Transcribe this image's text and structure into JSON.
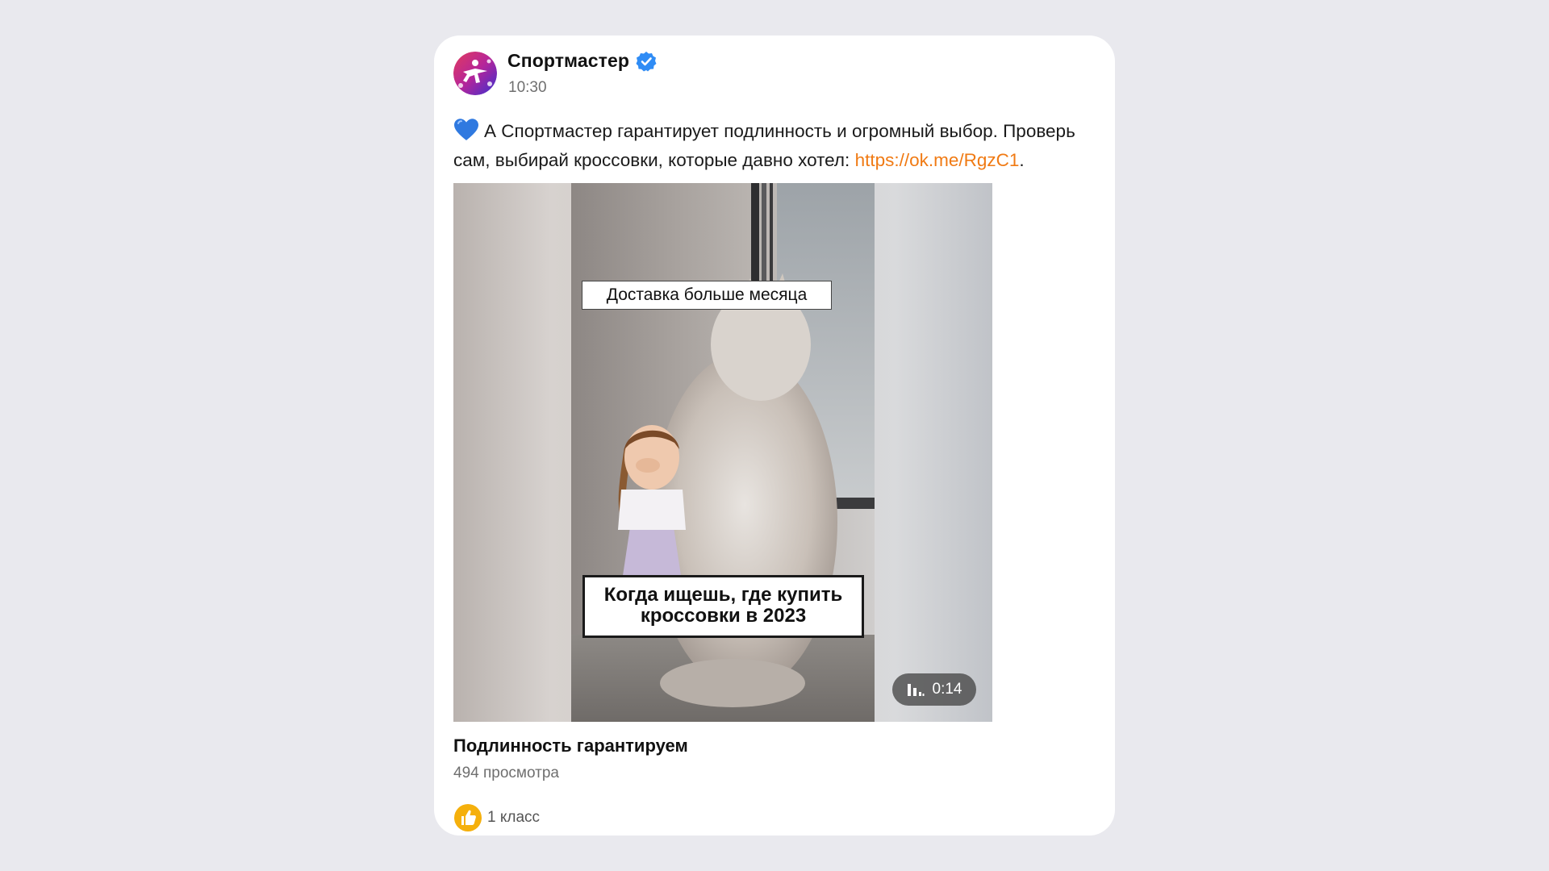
{
  "post": {
    "author": "Спортмастер",
    "time": "10:30",
    "text_emoji": "💙",
    "text_before_link": "А Спортмастер гарантирует подлинность и огромный выбор. Проверь сам, выбирай кроссовки, которые давно хотел: ",
    "link": "https://ok.me/RgzC1",
    "text_after_link": "."
  },
  "video": {
    "caption_top": "Доставка больше месяца",
    "caption_bottom_line1": "Когда ищешь, где купить",
    "caption_bottom_line2": "кроссовки в 2023",
    "duration": "0:14",
    "title": "Подлинность гарантируем",
    "views": "494 просмотра"
  },
  "reactions": {
    "likes_label": "1 класс"
  },
  "colors": {
    "page_bg": "#e9e9ee",
    "card_bg": "#ffffff",
    "link": "#f07a13",
    "verified": "#2f8cf5",
    "like": "#f5b00c",
    "heart": "#2f79e0"
  },
  "icons": {
    "verified": "verified-badge-icon",
    "heart": "blue-heart-icon",
    "audio": "audio-bars-icon",
    "like": "thumbs-up-icon"
  }
}
